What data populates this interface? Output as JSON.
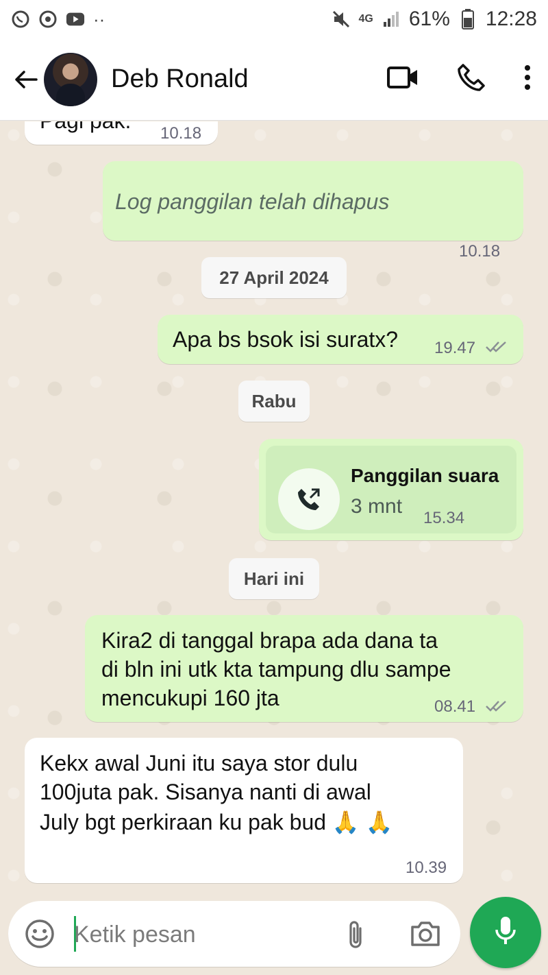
{
  "status_bar": {
    "network": "4G",
    "battery": "61%",
    "time": "12:28",
    "dots": "··"
  },
  "header": {
    "contact_name": "Deb Ronald"
  },
  "chat": {
    "messages": [
      {
        "type": "incoming",
        "text": "Pagi pak.",
        "time": "10.18"
      },
      {
        "type": "outgoing_system",
        "text": "Log panggilan telah dihapus",
        "time": "10.18"
      },
      {
        "type": "date",
        "text": "27 April 2024"
      },
      {
        "type": "outgoing",
        "text": "Apa bs bsok isi suratx?",
        "time": "19.47"
      },
      {
        "type": "date",
        "text": "Rabu"
      },
      {
        "type": "call",
        "title": "Panggilan suara",
        "duration": "3 mnt",
        "time": "15.34"
      },
      {
        "type": "date",
        "text": "Hari ini"
      },
      {
        "type": "outgoing",
        "lines": [
          "Kira2 di tanggal brapa ada dana ta",
          "di bln ini utk kta tampung dlu sampe",
          "mencukupi 160 jta"
        ],
        "time": "08.41"
      },
      {
        "type": "incoming",
        "lines": [
          "Kekx awal Juni itu saya stor dulu",
          "100juta pak. Sisanya nanti di awal",
          "July  bgt perkiraan ku pak bud 🙏 🙏"
        ],
        "time": "10.39"
      }
    ]
  },
  "composer": {
    "placeholder": "Ketik pesan"
  },
  "colors": {
    "outgoing_bubble": "#dcf8c6",
    "incoming_bubble": "#ffffff",
    "chat_bg": "#efe7dc",
    "accent": "#1fa855"
  }
}
